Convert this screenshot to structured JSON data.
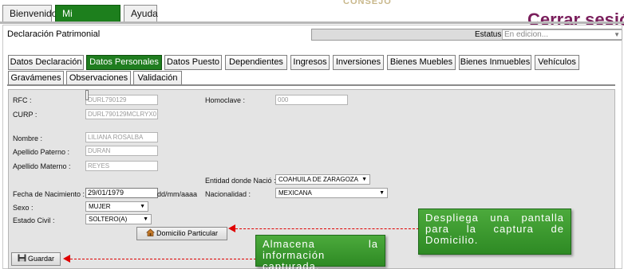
{
  "top_nav": {
    "tabs": [
      "Bienvenido",
      "Mi Declaración",
      "Ayuda"
    ],
    "active": "Mi Declaración"
  },
  "header": {
    "close_session": "Cerrar sesión",
    "logo_text": "CONSEJO"
  },
  "page": {
    "title": "Declaración Patrimonial",
    "status_label": "Estatus",
    "status_value": "En edicion..."
  },
  "tabs": {
    "row1": [
      "Datos Declaración",
      "Datos Personales",
      "Datos Puesto",
      "Dependientes",
      "Ingresos",
      "Inversiones",
      "Bienes Muebles",
      "Bienes Inmuebles",
      "Vehículos"
    ],
    "row2": [
      "Gravámenes",
      "Observaciones",
      "Validación"
    ],
    "active": "Datos Personales"
  },
  "form": {
    "rfc_label": "RFC :",
    "rfc_value": "DURL790129",
    "homoclave_label": "Homoclave :",
    "homoclave_value": "000",
    "curp_label": "CURP :",
    "curp_value": "DURL790129MCLRYX0",
    "nombre_label": "Nombre :",
    "nombre_value": "LILIANA ROSALBA",
    "paterno_label": "Apellido Paterno :",
    "paterno_value": "DURAN",
    "materno_label": "Apellido Materno :",
    "materno_value": "REYES",
    "entidad_label": "Entidad donde Nació :",
    "entidad_value": "COAHUILA DE ZARAGOZA",
    "fecha_label": "Fecha de Nacimiento :",
    "fecha_value": "29/01/1979",
    "fecha_format": "dd/mm/aaaa",
    "nacionalidad_label": "Nacionalidad :",
    "nacionalidad_value": "MEXICANA",
    "sexo_label": "Sexo :",
    "sexo_value": "MUJER",
    "civil_label": "Estado Civil :",
    "civil_value": "SOLTERO(A)",
    "domicilio_button": "Domicilio Particular",
    "guardar_button": "Guardar"
  },
  "annotations": {
    "domicilio_note": "Despliega una pantalla para la captura de Domicilio.",
    "guardar_note": "Almacena la información capturada."
  },
  "colors": {
    "accent_green": "#1f7d1f",
    "callout_green": "#3a9a30",
    "arrow_red": "#e00000",
    "brand_purple": "#7a1f5c"
  }
}
